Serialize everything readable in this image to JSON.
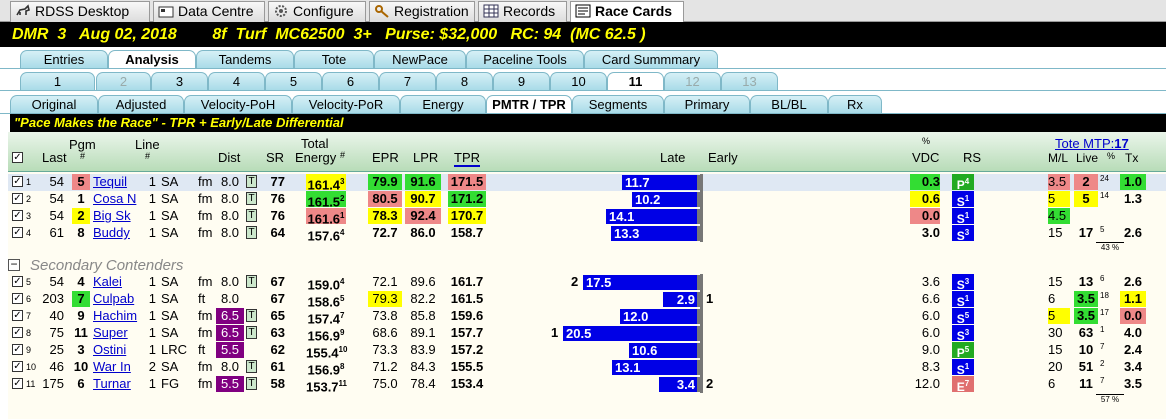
{
  "app_tabs": [
    {
      "label": "RDSS Desktop",
      "icon": "horse-icon"
    },
    {
      "label": "Data Centre",
      "icon": "folder-icon"
    },
    {
      "label": "Configure",
      "icon": "gear-icon"
    },
    {
      "label": "Registration",
      "icon": "key-icon"
    },
    {
      "label": "Records",
      "icon": "table-icon"
    },
    {
      "label": "Race Cards",
      "icon": "card-icon"
    }
  ],
  "header": {
    "track": "DMR",
    "race": "3",
    "date": "Aug 02, 2018",
    "dist": "8f",
    "surface": "Turf",
    "cls": "MC62500",
    "age": "3+",
    "purse": "Purse: $32,000",
    "rc": "RC: 94",
    "mc": "(MC 62.5 )"
  },
  "tabs1": [
    "Entries",
    "Analysis",
    "Tandems",
    "Tote",
    "NewPace",
    "Paceline Tools",
    "Card Summmary"
  ],
  "tabs2": [
    "1",
    "2",
    "3",
    "4",
    "5",
    "6",
    "7",
    "8",
    "9",
    "10",
    "11",
    "12",
    "13"
  ],
  "tabs3": [
    "Original",
    "Adjusted",
    "Velocity-PoH",
    "Velocity-PoR",
    "Energy",
    "PMTR / TPR",
    "Segments",
    "Primary",
    "BL/BL",
    "Rx"
  ],
  "subtitle": "\"Pace Makes the Race\" - TPR + Early/Late Differential",
  "cols": {
    "last": "Last",
    "pgm": "Pgm",
    "pgm_hash": "#",
    "line": "Line",
    "line_hash": "#",
    "dist": "Dist",
    "sr": "SR",
    "total": "Total",
    "energy": "Energy",
    "energy_hash": "#",
    "epr": "EPR",
    "lpr": "LPR",
    "tpr": "TPR",
    "late": "Late",
    "early": "Early",
    "pct": "%",
    "vdc": "VDC",
    "rs": "RS",
    "tote": "Tote MTP:",
    "mtp": "17",
    "ml": "M/L",
    "live": "Live",
    "pc": "%",
    "tx": "Tx"
  },
  "secondary_label": "Secondary Contenders",
  "colors": {
    "green": "#33dd33",
    "yellow": "#ffff00",
    "red": "#ee8888",
    "purple": "#800080",
    "blue": "#0000e6"
  },
  "top_rows": [
    {
      "n": "1",
      "last": "54",
      "pgm": "5",
      "name": "Tequil",
      "line": "1",
      "trk": "SA",
      "surf": "fm",
      "dist": "8.0",
      "sr": "77",
      "energy": "161.4",
      "erank": "3",
      "epr": "79.9",
      "lpr": "91.6",
      "tpr": "171.5",
      "late": "11.7",
      "vdc": "0.3",
      "rs": "P",
      "rsn": "4",
      "ml": "3.5",
      "live": "2",
      "pc": "24",
      "tx": "1.0"
    },
    {
      "n": "2",
      "last": "54",
      "pgm": "1",
      "name": "Cosa N",
      "line": "1",
      "trk": "SA",
      "surf": "fm",
      "dist": "8.0",
      "sr": "76",
      "energy": "161.5",
      "erank": "2",
      "epr": "80.5",
      "lpr": "90.7",
      "tpr": "171.2",
      "late": "10.2",
      "vdc": "0.6",
      "rs": "S",
      "rsn": "1",
      "ml": "5",
      "live": "5",
      "pc": "14",
      "tx": "1.3"
    },
    {
      "n": "3",
      "last": "54",
      "pgm": "2",
      "name": "Big Sk",
      "line": "1",
      "trk": "SA",
      "surf": "fm",
      "dist": "8.0",
      "sr": "76",
      "energy": "161.6",
      "erank": "1",
      "epr": "78.3",
      "lpr": "92.4",
      "tpr": "170.7",
      "late": "14.1",
      "vdc": "0.0",
      "rs": "S",
      "rsn": "1",
      "ml": "4.5",
      "live": "",
      "pc": "",
      "tx": ""
    },
    {
      "n": "4",
      "last": "61",
      "pgm": "8",
      "name": "Buddy",
      "line": "1",
      "trk": "SA",
      "surf": "fm",
      "dist": "8.0",
      "sr": "64",
      "energy": "157.6",
      "erank": "4",
      "epr": "72.7",
      "lpr": "86.0",
      "tpr": "158.7",
      "late": "13.3",
      "vdc": "3.0",
      "rs": "S",
      "rsn": "3",
      "ml": "15",
      "live": "17",
      "pc": "5",
      "tx": "2.6"
    }
  ],
  "top_total_pct": "43 %",
  "sec_rows": [
    {
      "n": "5",
      "last": "54",
      "pgm": "4",
      "name": "Kalei",
      "line": "1",
      "trk": "SA",
      "surf": "fm",
      "dist": "8.0",
      "sr": "67",
      "energy": "159.0",
      "erank": "4",
      "epr": "72.1",
      "lpr": "89.6",
      "tpr": "161.7",
      "late": "17.5",
      "early": "",
      "lead": "2",
      "vdc": "3.6",
      "rs": "S",
      "rsn": "3",
      "ml": "15",
      "live": "13",
      "pc": "6",
      "tx": "2.6"
    },
    {
      "n": "6",
      "last": "203",
      "pgm": "7",
      "name": "Culpab",
      "line": "1",
      "trk": "SA",
      "surf": "ft",
      "dist": "8.0",
      "sr": "67",
      "energy": "158.6",
      "erank": "5",
      "epr": "79.3",
      "lpr": "82.2",
      "tpr": "161.5",
      "late": "",
      "early": "2.9",
      "lead": "1",
      "vdc": "6.6",
      "rs": "S",
      "rsn": "1",
      "ml": "6",
      "live": "3.5",
      "pc": "18",
      "tx": "1.1"
    },
    {
      "n": "7",
      "last": "40",
      "pgm": "9",
      "name": "Hachim",
      "line": "1",
      "trk": "SA",
      "surf": "fm",
      "dist": "6.5",
      "sr": "65",
      "energy": "157.4",
      "erank": "7",
      "epr": "73.8",
      "lpr": "85.8",
      "tpr": "159.6",
      "late": "12.0",
      "early": "",
      "lead": "",
      "vdc": "6.0",
      "rs": "S",
      "rsn": "5",
      "ml": "5",
      "live": "3.5",
      "pc": "17",
      "tx": "0.0"
    },
    {
      "n": "8",
      "last": "75",
      "pgm": "11",
      "name": "Super",
      "line": "1",
      "trk": "SA",
      "surf": "fm",
      "dist": "6.5",
      "sr": "63",
      "energy": "156.9",
      "erank": "9",
      "epr": "68.6",
      "lpr": "89.1",
      "tpr": "157.7",
      "late": "20.5",
      "early": "",
      "lead": "1",
      "vdc": "6.0",
      "rs": "S",
      "rsn": "3",
      "ml": "30",
      "live": "63",
      "pc": "1",
      "tx": "4.0"
    },
    {
      "n": "9",
      "last": "25",
      "pgm": "3",
      "name": "Ostini",
      "line": "1",
      "trk": "LRC",
      "surf": "ft",
      "dist": "5.5",
      "sr": "62",
      "energy": "155.4",
      "erank": "10",
      "epr": "73.3",
      "lpr": "83.9",
      "tpr": "157.2",
      "late": "10.6",
      "early": "",
      "lead": "",
      "vdc": "9.0",
      "rs": "P",
      "rsn": "5",
      "ml": "15",
      "live": "10",
      "pc": "7",
      "tx": "2.4"
    },
    {
      "n": "10",
      "last": "46",
      "pgm": "10",
      "name": "War In",
      "line": "2",
      "trk": "SA",
      "surf": "fm",
      "dist": "8.0",
      "sr": "61",
      "energy": "156.9",
      "erank": "8",
      "epr": "71.2",
      "lpr": "84.3",
      "tpr": "155.5",
      "late": "13.1",
      "early": "",
      "lead": "",
      "vdc": "8.3",
      "rs": "S",
      "rsn": "1",
      "ml": "20",
      "live": "51",
      "pc": "2",
      "tx": "3.4"
    },
    {
      "n": "11",
      "last": "175",
      "pgm": "6",
      "name": "Turnar",
      "line": "1",
      "trk": "FG",
      "surf": "fm",
      "dist": "5.5",
      "sr": "58",
      "energy": "153.7",
      "erank": "11",
      "epr": "75.0",
      "lpr": "78.4",
      "tpr": "153.4",
      "late": "",
      "early": "3.4",
      "lead": "2",
      "vdc": "12.0",
      "rs": "E",
      "rsn": "7",
      "ml": "6",
      "live": "11",
      "pc": "7",
      "tx": "3.5"
    }
  ],
  "sec_total_pct": "57 %"
}
